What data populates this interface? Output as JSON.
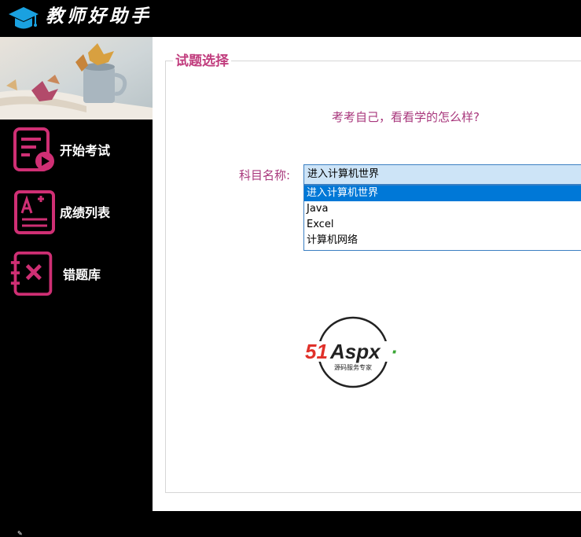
{
  "header": {
    "title": "教师好助手",
    "icon": "graduation-cap-icon"
  },
  "sidebar": {
    "banner": "autumn-leaves-cup-image",
    "items": [
      {
        "label": "开始考试",
        "icon": "exam-start-icon"
      },
      {
        "label": "成绩列表",
        "icon": "grade-list-icon"
      },
      {
        "label": "错题库",
        "icon": "wrong-questions-icon"
      }
    ]
  },
  "main": {
    "legend": "试题选择",
    "subtitle": "考考自己，看看学的怎么样?",
    "subject_label": "科目名称:",
    "select": {
      "value": "进入计算机世界",
      "options": [
        "进入计算机世界",
        "Java",
        "Excel",
        "计算机网络"
      ],
      "selected_index": 0
    },
    "logo": {
      "name": "51Aspx",
      "tagline": "源码服务专家"
    }
  },
  "colors": {
    "accent": "#c13d7e",
    "label": "#a8377c",
    "select_bg": "#cde4f7",
    "option_highlight": "#0078d7",
    "icon": "#cf2f74"
  }
}
